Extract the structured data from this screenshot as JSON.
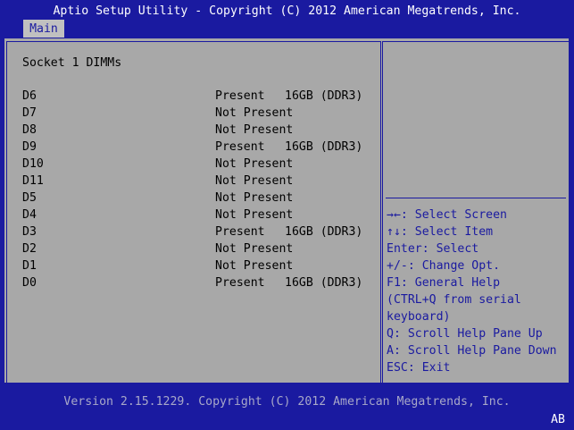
{
  "header": {
    "title": "Aptio Setup Utility - Copyright (C) 2012 American Megatrends, Inc.",
    "tabs": [
      {
        "label": "Main"
      }
    ]
  },
  "main": {
    "heading": "Socket 1 DIMMs",
    "dimms": [
      {
        "slot": "D6",
        "status": "Present",
        "size": "16GB (DDR3)"
      },
      {
        "slot": "D7",
        "status": "Not Present",
        "size": ""
      },
      {
        "slot": "D8",
        "status": "Not Present",
        "size": ""
      },
      {
        "slot": "D9",
        "status": "Present",
        "size": "16GB (DDR3)"
      },
      {
        "slot": "D10",
        "status": "Not Present",
        "size": ""
      },
      {
        "slot": "D11",
        "status": "Not Present",
        "size": ""
      },
      {
        "slot": "D5",
        "status": "Not Present",
        "size": ""
      },
      {
        "slot": "D4",
        "status": "Not Present",
        "size": ""
      },
      {
        "slot": "D3",
        "status": "Present",
        "size": "16GB (DDR3)"
      },
      {
        "slot": "D2",
        "status": "Not Present",
        "size": ""
      },
      {
        "slot": "D1",
        "status": "Not Present",
        "size": ""
      },
      {
        "slot": "D0",
        "status": "Present",
        "size": "16GB (DDR3)"
      }
    ]
  },
  "help": {
    "lines": [
      "→←: Select Screen",
      "↑↓: Select Item",
      "Enter: Select",
      "+/-: Change Opt.",
      "F1: General Help",
      "(CTRL+Q from serial",
      "keyboard)",
      "Q: Scroll Help Pane Up",
      "A: Scroll Help Pane Down",
      "ESC: Exit"
    ]
  },
  "footer": {
    "version": "Version 2.15.1229. Copyright (C) 2012 American Megatrends, Inc.",
    "corner": "AB"
  },
  "colors": {
    "background": "#1a1aa0",
    "panel": "#a8a8a8",
    "text": "#000000",
    "help_text": "#1a1aa0",
    "footer_text": "#a8a8c8"
  }
}
